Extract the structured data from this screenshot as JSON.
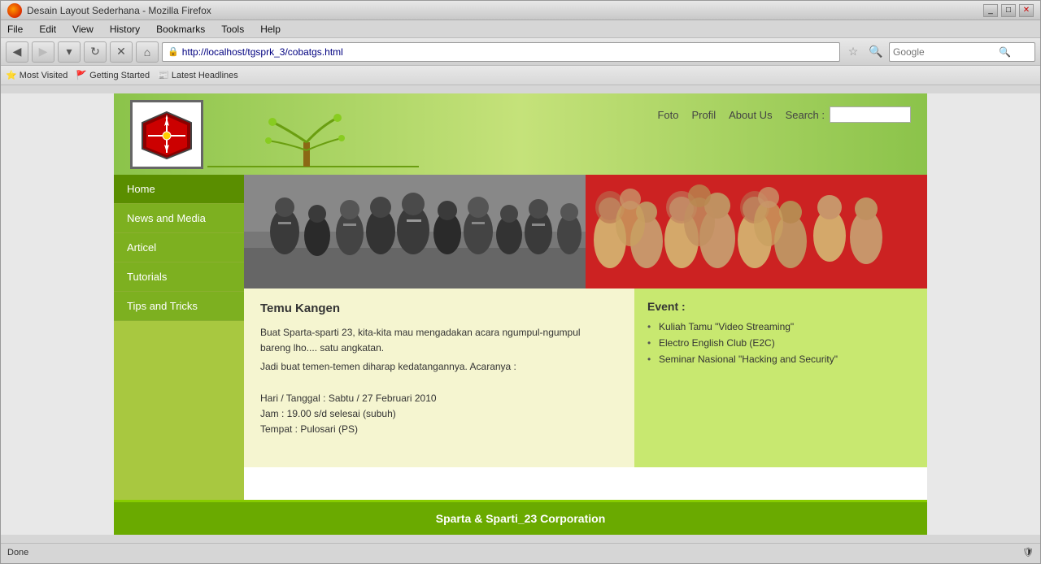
{
  "browser": {
    "title": "Desain Layout Sederhana - Mozilla Firefox",
    "address": "http://localhost/tgsprk_3/cobatgs.html",
    "search_placeholder": "Google",
    "window_controls": [
      "minimize",
      "maximize",
      "close"
    ]
  },
  "menu": {
    "items": [
      "File",
      "Edit",
      "View",
      "History",
      "Bookmarks",
      "Tools",
      "Help"
    ]
  },
  "bookmarks": {
    "items": [
      "Most Visited",
      "Getting Started",
      "Latest Headlines"
    ]
  },
  "header": {
    "nav_links": [
      "Foto",
      "Profil",
      "About Us"
    ],
    "search_label": "Search :"
  },
  "sidebar": {
    "items": [
      {
        "label": "Home",
        "active": true
      },
      {
        "label": "News and Media"
      },
      {
        "label": "Articel"
      },
      {
        "label": "Tutorials"
      },
      {
        "label": "Tips and Tricks"
      }
    ]
  },
  "article": {
    "title": "Temu Kangen",
    "body_lines": [
      "Buat Sparta-sparti 23, kita-kita mau mengadakan acara ngumpul-ngumpul",
      "bareng lho.... satu angkatan.",
      "Jadi buat temen-temen diharap kedatangannya. Acaranya :",
      "",
      "Hari / Tanggal : Sabtu / 27 Februari 2010",
      "Jam : 19.00 s/d selesai (subuh)",
      "Tempat : Pulosari (PS)"
    ]
  },
  "event": {
    "title": "Event :",
    "items": [
      "Kuliah Tamu \"Video Streaming\"",
      "Electro English Club (E2C)",
      "Seminar Nasional \"Hacking and Security\""
    ]
  },
  "footer": {
    "text": "Sparta & Sparti_23 Corporation"
  },
  "status": {
    "text": "Done",
    "security_icon": "shield"
  }
}
